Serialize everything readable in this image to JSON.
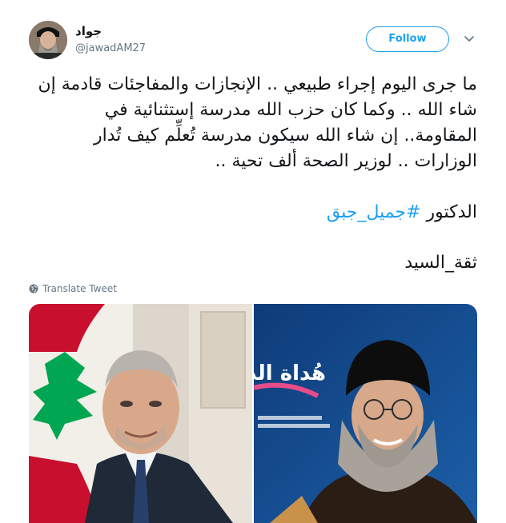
{
  "user": {
    "display_name": "جواد",
    "handle": "@jawadAM27",
    "avatar_icon": "profile-photo"
  },
  "follow_label": "Follow",
  "tweet": {
    "paragraph1": "ما جرى اليوم إجراء طبيعي .. الإنجازات والمفاجئات قادمة إن شاء الله .. وكما كان حزب الله مدرسة إستثنائية في المقاومة.. إن شاء الله سيكون مدرسة تُعلِّم كيف تُدار الوزارات .. لوزير الصحة ألف تحية ..",
    "paragraph2_text": "الدكتور",
    "hashtag": "#جميل_جبق",
    "paragraph3": "ثقة_السيد"
  },
  "translate_label": "Translate Tweet",
  "media": {
    "right_banner_text": "هُداة الد"
  },
  "colors": {
    "accent": "#1da1f2",
    "secondary_text": "#657786",
    "primary_text": "#14171a"
  }
}
